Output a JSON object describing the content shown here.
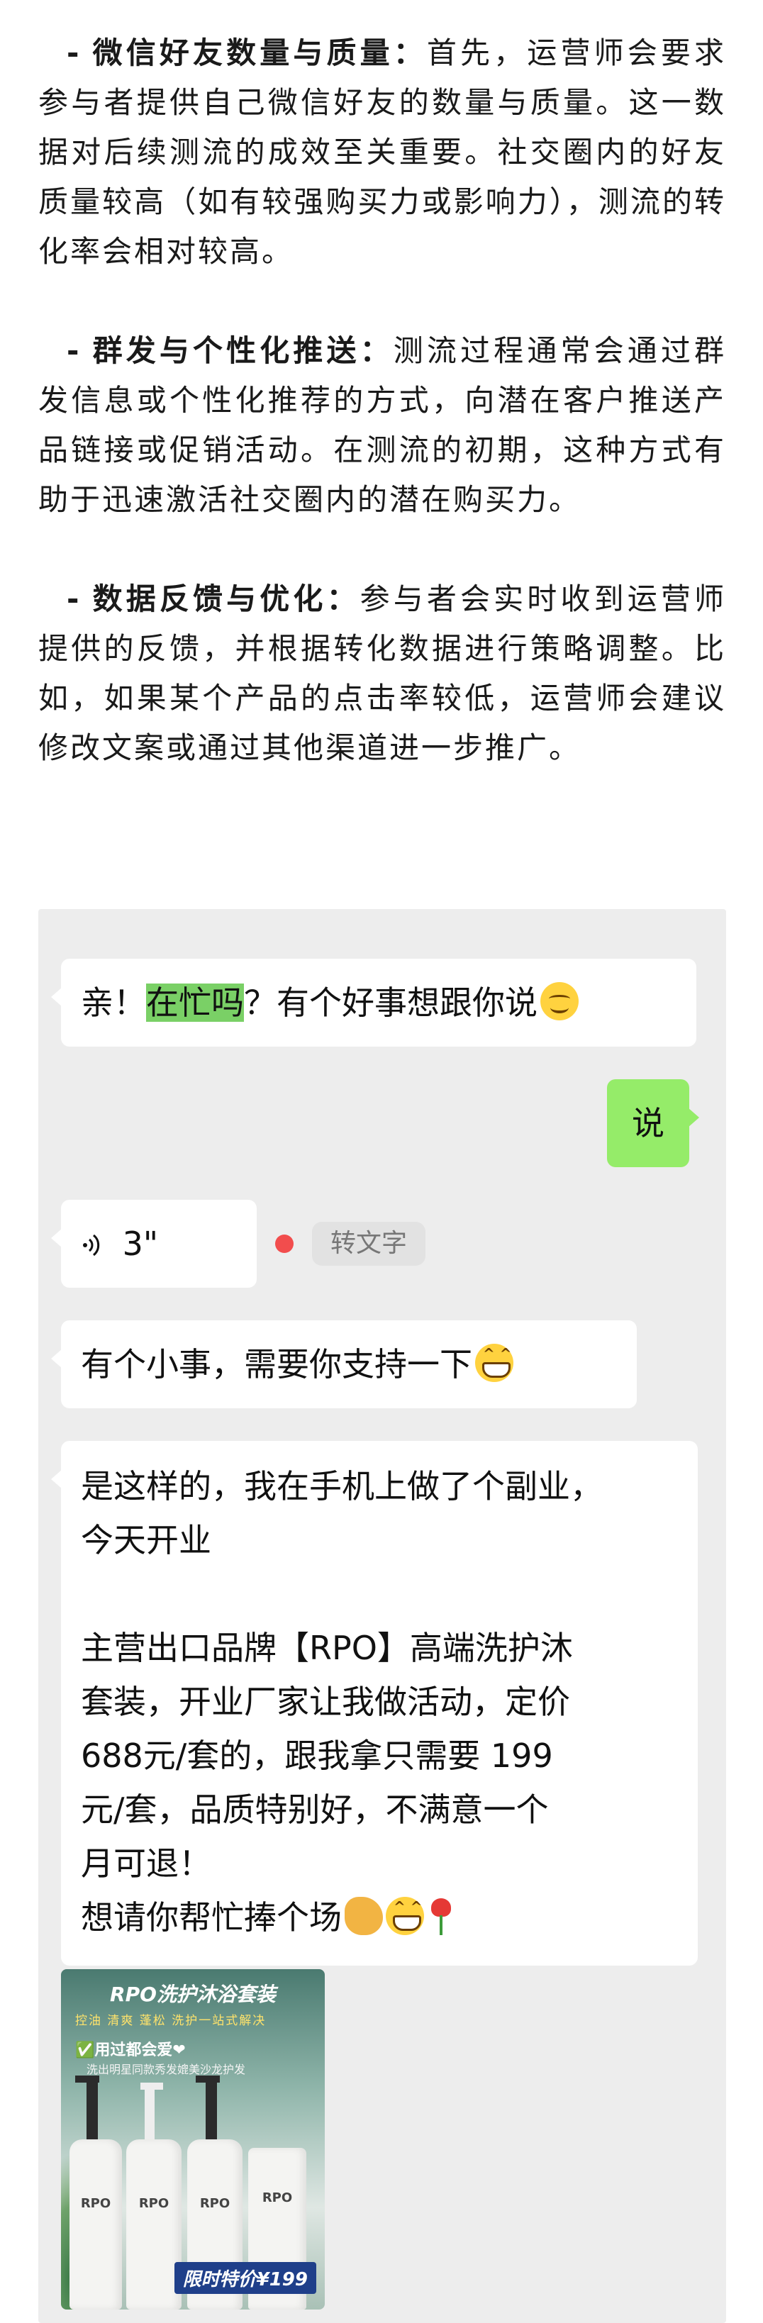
{
  "article": {
    "p1": {
      "title": "微信好友数量与质量：",
      "text": "首先，运营师会要求参与者提供自己微信好友的数量与质量。这一数据对后续测流的成效至关重要。社交圈内的好友质量较高（如有较强购买力或影响力），测流的转化率会相对较高。"
    },
    "p2": {
      "title": "群发与个性化推送：",
      "text": "测流过程通常会通过群发信息或个性化推荐的方式，向潜在客户推送产品链接或促销活动。在测流的初期，这种方式有助于迅速激活社交圈内的潜在购买力。"
    },
    "p3": {
      "title": "数据反馈与优化：",
      "text": "参与者会实时收到运营师提供的反馈，并根据转化数据进行策略调整。比如，如果某个产品的点击率较低，运营师会建议修改文案或通过其他渠道进一步推广。"
    },
    "dash": "-"
  },
  "chat": {
    "msg1": {
      "pre": "亲！",
      "highlight": "在忙吗",
      "post": "？有个好事想跟你说"
    },
    "msg2": "说",
    "voice": {
      "duration": "3\"",
      "transcribe_label": "转文字"
    },
    "msg3": "有个小事，需要你支持一下",
    "msg4": {
      "line1": "是这样的，我在手机上做了个副业，",
      "line2": "今天开业",
      "line3": "主营出口品牌【RPO】高端洗护沐",
      "line4": "套装，开业厂家让我做活动，定价",
      "line5": "688元/套的，跟我拿只需要 199",
      "line6": "元/套，品质特别好，不满意一个",
      "line7": "月可退！",
      "line8": "想请你帮忙捧个场"
    },
    "product_image": {
      "title": "RPO洗护沐浴套装",
      "tags": "控油 清爽 蓬松 洗护一站式解决",
      "badge": "✅用过都会爱❤",
      "badge_sub": "洗出明星同款秀发媲美沙龙护发",
      "bottle_label": "RPO",
      "price": "限时特价¥199"
    }
  },
  "colors": {
    "chat_bg": "#ededed",
    "self_bubble": "#95ec69",
    "highlight": "#7ad066",
    "red_dot": "#f24d4d"
  }
}
